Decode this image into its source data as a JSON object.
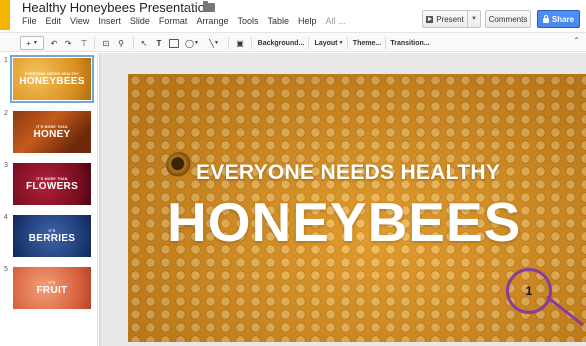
{
  "header": {
    "title": "Healthy Honeybees Presentation",
    "present_label": "Present",
    "comments_label": "Comments",
    "share_label": "Share"
  },
  "menu": [
    "File",
    "Edit",
    "View",
    "Insert",
    "Slide",
    "Format",
    "Arrange",
    "Tools",
    "Table",
    "Help",
    "All ..."
  ],
  "toolbar": {
    "background_label": "Background...",
    "layout_label": "Layout",
    "theme_label": "Theme...",
    "transition_label": "Transition..."
  },
  "slides": [
    {
      "number": "1",
      "small": "EVERYONE NEEDS HEALTHY",
      "big": "HONEYBEES"
    },
    {
      "number": "2",
      "small": "IT'S MORE THAN",
      "big": "HONEY"
    },
    {
      "number": "3",
      "small": "IT'S MORE THAN",
      "big": "FLOWERS"
    },
    {
      "number": "4",
      "small": "IT'S",
      "big": "BERRIES"
    },
    {
      "number": "5",
      "small": "IT'S",
      "big": "FRUIT"
    }
  ],
  "current_slide": {
    "subtitle": "EVERYONE NEEDS HEALTHY",
    "title": "HONEYBEES"
  },
  "callout": {
    "label": "1"
  },
  "colors": {
    "share_blue": "#4d90fe",
    "logo_yellow": "#f4b400",
    "callout_purple": "#8a3c9a",
    "selected_thumb": "#6fa8dc"
  }
}
